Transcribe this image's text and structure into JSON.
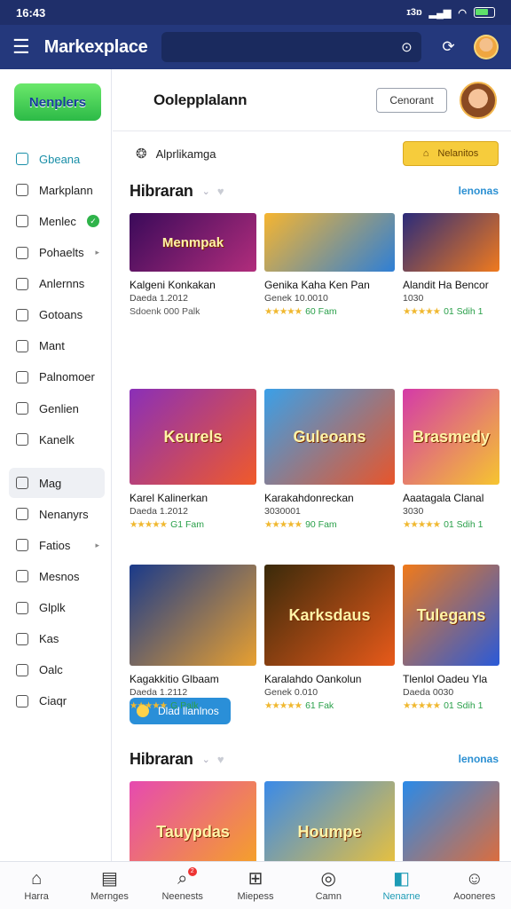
{
  "status_bar": {
    "time": "16:43",
    "network": "ɪ3ɒ"
  },
  "app_bar": {
    "title": "Markexplace",
    "search_value": ""
  },
  "sidebar": {
    "logo_text": "Nenplers",
    "items": [
      {
        "label": "Gbeana",
        "icon": "home-icon",
        "active": true
      },
      {
        "label": "Markplann",
        "icon": "store-icon"
      },
      {
        "label": "Menlec",
        "icon": "box-icon",
        "badge": "✓"
      },
      {
        "label": "Pohaelts",
        "icon": "puzzle-icon",
        "chevron": "▸"
      },
      {
        "label": "Anlernns",
        "icon": "people-icon"
      },
      {
        "label": "Gotoans",
        "icon": "clock-icon"
      },
      {
        "label": "Mant",
        "icon": "check-icon"
      },
      {
        "label": "Palnomoer",
        "icon": "tag-icon"
      },
      {
        "label": "Genlien",
        "icon": "calendar-icon"
      },
      {
        "label": "Kanelk",
        "icon": "mail-icon"
      },
      {
        "label": "Mag",
        "icon": "chart-icon",
        "selected": true
      },
      {
        "label": "Nenanyrs",
        "icon": "compass-icon"
      },
      {
        "label": "Fatios",
        "icon": "folder-icon",
        "chevron": "▸"
      },
      {
        "label": "Mesnos",
        "icon": "link-icon"
      },
      {
        "label": "Glplk",
        "icon": "grid-icon"
      },
      {
        "label": "Kas",
        "icon": "file-icon"
      },
      {
        "label": "Oalc",
        "icon": "circle-icon"
      },
      {
        "label": "Ciaqr",
        "icon": "square-icon"
      }
    ]
  },
  "main": {
    "title": "Oolepplalann",
    "header_button": "Cenorant",
    "filter_text": "Alprlikamga",
    "filter_button": "Nelanitos",
    "sections": [
      {
        "title": "Hibraran",
        "link": "lenonas",
        "rows": [
          [
            {
              "thumb": "Menmpak",
              "title": "Kalgeni Konkakan",
              "sub": "Daeda 1.2012",
              "rating": "Sdoenk 000 Palk",
              "stars": false,
              "colors": [
                "#3a0a5a",
                "#b12d7c"
              ]
            },
            {
              "thumb": "",
              "title": "Genika Kaha Ken Pan",
              "sub": "Genek 10.0010",
              "rating": "60 Fam",
              "stars": true,
              "colors": [
                "#f6b530",
                "#2e7fd6"
              ]
            },
            {
              "thumb": "",
              "title": "Alandit Ha Bencor",
              "sub": "1030",
              "rating": "01 Sdih 1",
              "stars": true,
              "colors": [
                "#2b2b7a",
                "#f07a1e"
              ]
            }
          ],
          [
            {
              "thumb": "Keurels",
              "title": "Karel Kalinerkan",
              "sub": "Daeda 1.2012",
              "rating": "G1 Fam",
              "stars": true,
              "colors": [
                "#8a2fb8",
                "#f05a2a"
              ]
            },
            {
              "thumb": "Guleoans",
              "title": "Karakahdonreckan",
              "sub": "3030001",
              "rating": "90 Fam",
              "stars": true,
              "colors": [
                "#3aa0e8",
                "#e8552a"
              ]
            },
            {
              "thumb": "Brasmedy",
              "title": "Aaatagala Clanal",
              "sub": "3030",
              "rating": "01 Sdih 1",
              "stars": true,
              "colors": [
                "#d43aa8",
                "#f6c530"
              ]
            }
          ],
          [
            {
              "thumb": "",
              "title": "Kagakkitio Glbaam",
              "sub": "Daeda 1.2112",
              "rating": "G Palk",
              "stars": true,
              "colors": [
                "#1a3a8a",
                "#e8a030"
              ]
            },
            {
              "thumb": "Karksdaus",
              "title": "Karalahdo Oankolun",
              "sub": "Genek 0.010",
              "rating": "61 Fak",
              "stars": true,
              "colors": [
                "#3a2a0a",
                "#e85a1a"
              ]
            },
            {
              "thumb": "Tulegans",
              "title": "Tlenlol Oadeu Yla",
              "sub": "Daeda 0030",
              "rating": "01 Sdih 1",
              "stars": true,
              "colors": [
                "#f07a1a",
                "#2a5ad8"
              ]
            }
          ]
        ],
        "more_button": "Dlad llanlnos"
      },
      {
        "title": "Hibraran",
        "link": "lenonas",
        "rows": [
          [
            {
              "thumb": "Tauypdas",
              "colors": [
                "#e64ab0",
                "#f6a81e"
              ]
            },
            {
              "thumb": "Houmpe",
              "colors": [
                "#3a8ae8",
                "#f6c530"
              ]
            },
            {
              "thumb": "",
              "colors": [
                "#2a8ae8",
                "#f06a2a"
              ]
            }
          ]
        ]
      }
    ]
  },
  "bottom_nav": [
    {
      "label": "Harra",
      "icon": "home-icon"
    },
    {
      "label": "Mernges",
      "icon": "book-icon"
    },
    {
      "label": "Neenests",
      "icon": "search-icon",
      "badge": "2"
    },
    {
      "label": "Miepess",
      "icon": "grid-icon"
    },
    {
      "label": "Camn",
      "icon": "target-icon"
    },
    {
      "label": "Nenarne",
      "icon": "bookmark-icon",
      "active": true
    },
    {
      "label": "Aooneres",
      "icon": "user-icon"
    }
  ]
}
